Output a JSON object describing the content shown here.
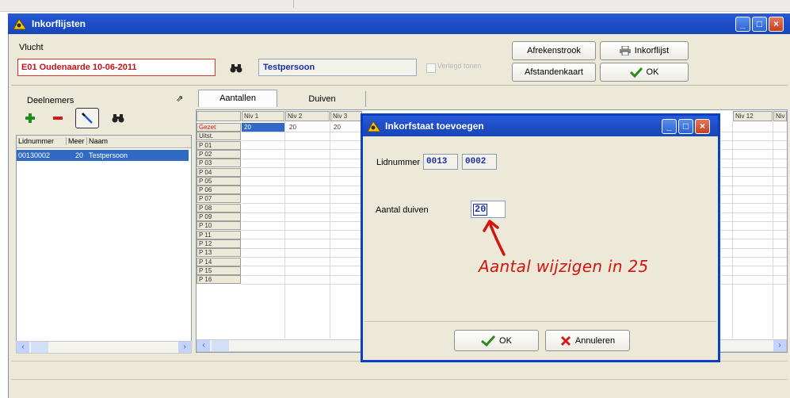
{
  "window": {
    "title": "Inkorflijsten"
  },
  "vlucht": {
    "label": "Vlucht",
    "value": "E01 Oudenaarde 10-06-2011",
    "person": "Testpersoon",
    "checkbox_label": "Verlegd tonen"
  },
  "buttons": {
    "afrekenstrook": "Afrekenstrook",
    "afstandenkaart": "Afstandenkaart",
    "inkorflijst": "Inkorflijst",
    "ok": "OK"
  },
  "deelnemers": {
    "label": "Deelnemers",
    "columns": [
      "Lidnummer",
      "Meer",
      "Naam"
    ],
    "rows": [
      {
        "lidnummer": "00130002",
        "meer": "20",
        "naam": "Testpersoon"
      }
    ]
  },
  "tabs": [
    "Aantallen",
    "Duiven"
  ],
  "grid": {
    "col_headers": [
      "Niv 1",
      "Niv 2",
      "Niv 3"
    ],
    "col_headers_right": [
      "Niv 12",
      "Niv"
    ],
    "row_headers": [
      "Gezet",
      "Uitst.",
      "P 01",
      "P 02",
      "P 03",
      "P 04",
      "P 05",
      "P 06",
      "P 07",
      "P 08",
      "P 09",
      "P 10",
      "P 11",
      "P 12",
      "P 13",
      "P 14",
      "P 15",
      "P 16"
    ],
    "first_row_values": [
      "20",
      "20",
      "20"
    ]
  },
  "dialog": {
    "title": "Inkorfstaat toevoegen",
    "lidnummer_label": "Lidnummer",
    "lid_part1": "0013",
    "lid_part2": "0002",
    "aantal_label": "Aantal duiven",
    "aantal_value": "20",
    "annotation": "Aantal wijzigen in 25",
    "ok_label": "OK",
    "cancel_label": "Annuleren"
  },
  "colors": {
    "title_blue": "#1f4fc9",
    "selected_blue": "#316ac5",
    "annotation_red": "#d4140f",
    "dialog_border": "#0a3fc8",
    "field_text": "#1c2fa8"
  }
}
